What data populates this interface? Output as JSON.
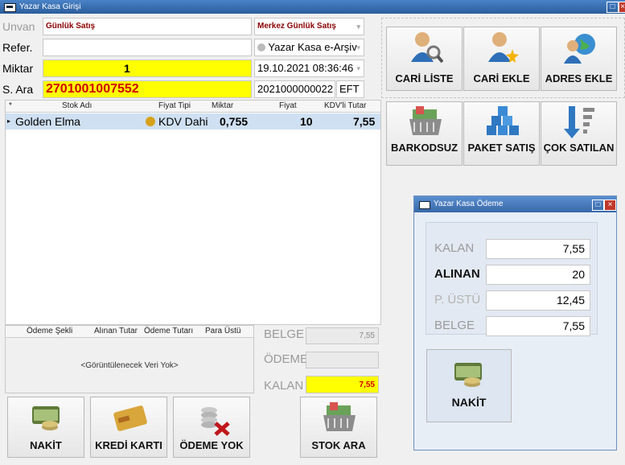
{
  "window": {
    "title": "Yazar Kasa Girişi"
  },
  "form": {
    "unvan_label": "Unvan",
    "unvan_value": "Günlük Satış",
    "refer_label": "Refer.",
    "refer_value": "",
    "miktar_label": "Miktar",
    "miktar_value": "1",
    "sara_label": "S. Ara",
    "sara_value": "2701001007552",
    "branch_value": "Merkez Günlük Satış",
    "document_type": "Yazar Kasa e-Arşiv",
    "datetime": "19.10.2021 08:36:46",
    "doc_number": "2021000000022",
    "eft_label": "EFT"
  },
  "grid": {
    "headers": [
      "Stok Adı",
      "Fiyat Tipi",
      "Miktar",
      "Fiyat",
      "KDV'li Tutar"
    ],
    "rows": [
      {
        "name": "Golden Elma",
        "price_type": "KDV Dahi",
        "qty": "0,755",
        "price": "10",
        "total": "7,55"
      }
    ]
  },
  "payment_grid": {
    "headers": [
      "Ödeme Şekli",
      "Alınan Tutar",
      "Ödeme Tutarı",
      "Para Üstü"
    ],
    "empty_text": "<Görüntülenecek Veri Yok>"
  },
  "summary": {
    "belge_label": "BELGE",
    "belge_value": "7,55",
    "odeme_label": "ÖDEME",
    "odeme_value": "",
    "kalan_label": "KALAN",
    "kalan_value": "7,55"
  },
  "bottom_buttons": [
    {
      "label": "NAKİT",
      "icon": "cash-icon"
    },
    {
      "label": "KREDİ KARTI",
      "icon": "credit-card-icon"
    },
    {
      "label": "ÖDEME YOK",
      "icon": "no-payment-icon"
    },
    {
      "label": "STOK ARA",
      "icon": "basket-icon"
    }
  ],
  "right_buttons": [
    {
      "label": "CARİ LİSTE",
      "icon": "user-search-icon"
    },
    {
      "label": "CARİ EKLE",
      "icon": "user-add-icon"
    },
    {
      "label": "ADRES EKLE",
      "icon": "globe-user-icon"
    },
    {
      "label": "BARKODSUZ",
      "icon": "basket-icon"
    },
    {
      "label": "PAKET SATIŞ",
      "icon": "boxes-icon"
    },
    {
      "label": "ÇOK SATILAN",
      "icon": "sort-down-icon"
    }
  ],
  "payment_dialog": {
    "title": "Yazar Kasa Ödeme",
    "kalan_label": "KALAN",
    "kalan_value": "7,55",
    "alinan_label": "ALINAN",
    "alinan_value": "20",
    "paraustu_label": "P. ÜSTÜ",
    "paraustu_value": "12,45",
    "belge_label": "BELGE",
    "belge_value": "7,55",
    "nakit_label": "NAKİT"
  },
  "colors": {
    "title_bar": "#2b5d9c",
    "highlight_yellow": "#ffff00",
    "dark_red": "#8b0000",
    "row_selected": "#cfe0f2"
  }
}
